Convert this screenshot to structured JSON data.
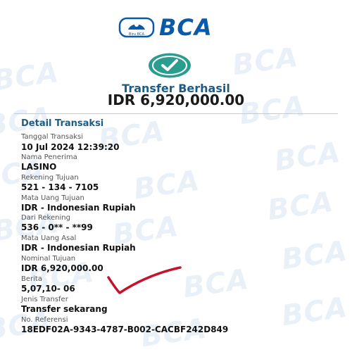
{
  "brand": {
    "name": "BCA",
    "emblem_label": "Biru BCA",
    "color": "#0a5aa8"
  },
  "status": {
    "icon": "check-icon",
    "title": "Transfer Berhasil",
    "amount": "IDR 6,920,000.00",
    "accent": "#2a9d8f"
  },
  "details": {
    "section_title": "Detail Transaksi",
    "fields": [
      {
        "label": "Tanggal Transaksi",
        "value": "10 Jul 2024 12:39:20"
      },
      {
        "label": "Nama Penerima",
        "value": "LASINO"
      },
      {
        "label": "Rekening Tujuan",
        "value": "521 - 134 - 7105"
      },
      {
        "label": "Mata Uang Tujuan",
        "value": "IDR - Indonesian Rupiah"
      },
      {
        "label": "Dari Rekening",
        "value": "536 - 0** - **99"
      },
      {
        "label": "Mata Uang Asal",
        "value": "IDR - Indonesian Rupiah"
      },
      {
        "label": "Nominal Tujuan",
        "value": "IDR 6,920,000.00"
      },
      {
        "label": "Berita",
        "value": "5,07,10- 06"
      },
      {
        "label": "Jenis Transfer",
        "value": "Transfer sekarang"
      },
      {
        "label": "No. Referensi",
        "value": "18EDF02A-9343-4787-B002-CACBF242D849"
      }
    ]
  },
  "annotation": {
    "icon": "handwritten-checkmark-icon",
    "color": "#c4132a"
  }
}
